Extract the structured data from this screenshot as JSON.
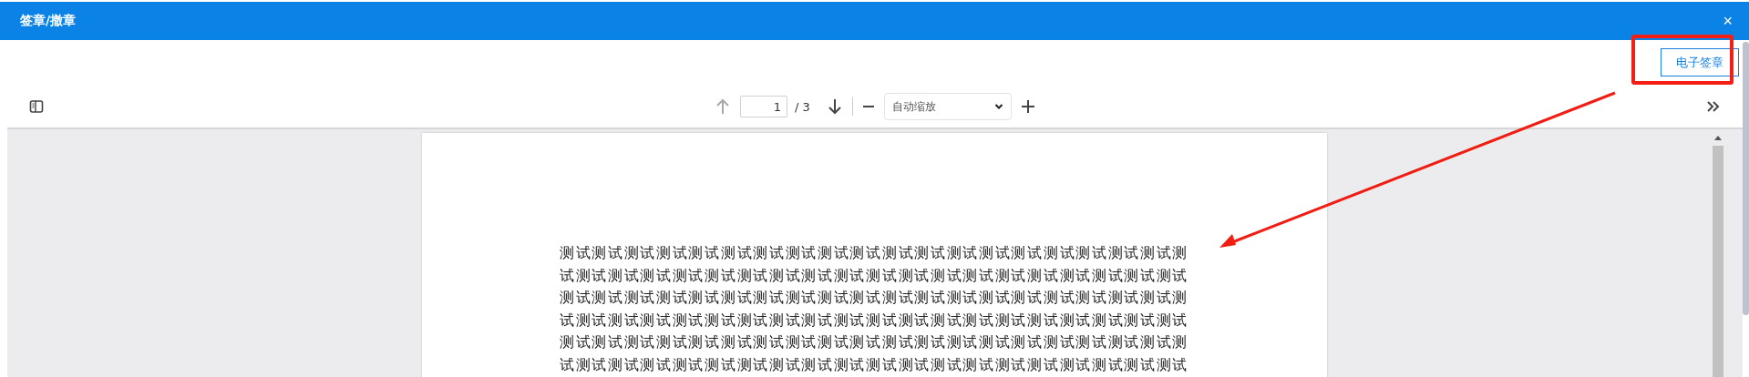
{
  "window": {
    "title": "签章/撤章",
    "close": "×"
  },
  "action_button": {
    "label": "电子签章"
  },
  "toolbar": {
    "previous_page": {
      "disabled": true
    },
    "next_page": {
      "disabled": false
    },
    "page_input": {
      "value": "1"
    },
    "page_count": "/ 3",
    "zoom_select": {
      "value": "自动缩放"
    }
  },
  "document": {
    "lines": [
      "测试测试测试测试测试测试测试测试测试测试测试测试测试测试测试测试测试测试测试测",
      "试测试测试测试测试测试测试测试测试测试测试测试测试测试测试测试测试测试测试测试",
      "测试测试测试测试测试测试测试测试测试测试测试测试测试测试测试测试测试测试测试测",
      "试测试测试测试测试测试测试测试测试测试测试测试测试测试测试测试测试测试测试测试",
      "测试测试测试测试测试测试测试测试测试测试测试测试测试测试测试测试测试测试测试测",
      "试测试测试测试测试测试测试测试测试测试测试测试测试测试测试测试测试测试测试测试"
    ]
  }
}
